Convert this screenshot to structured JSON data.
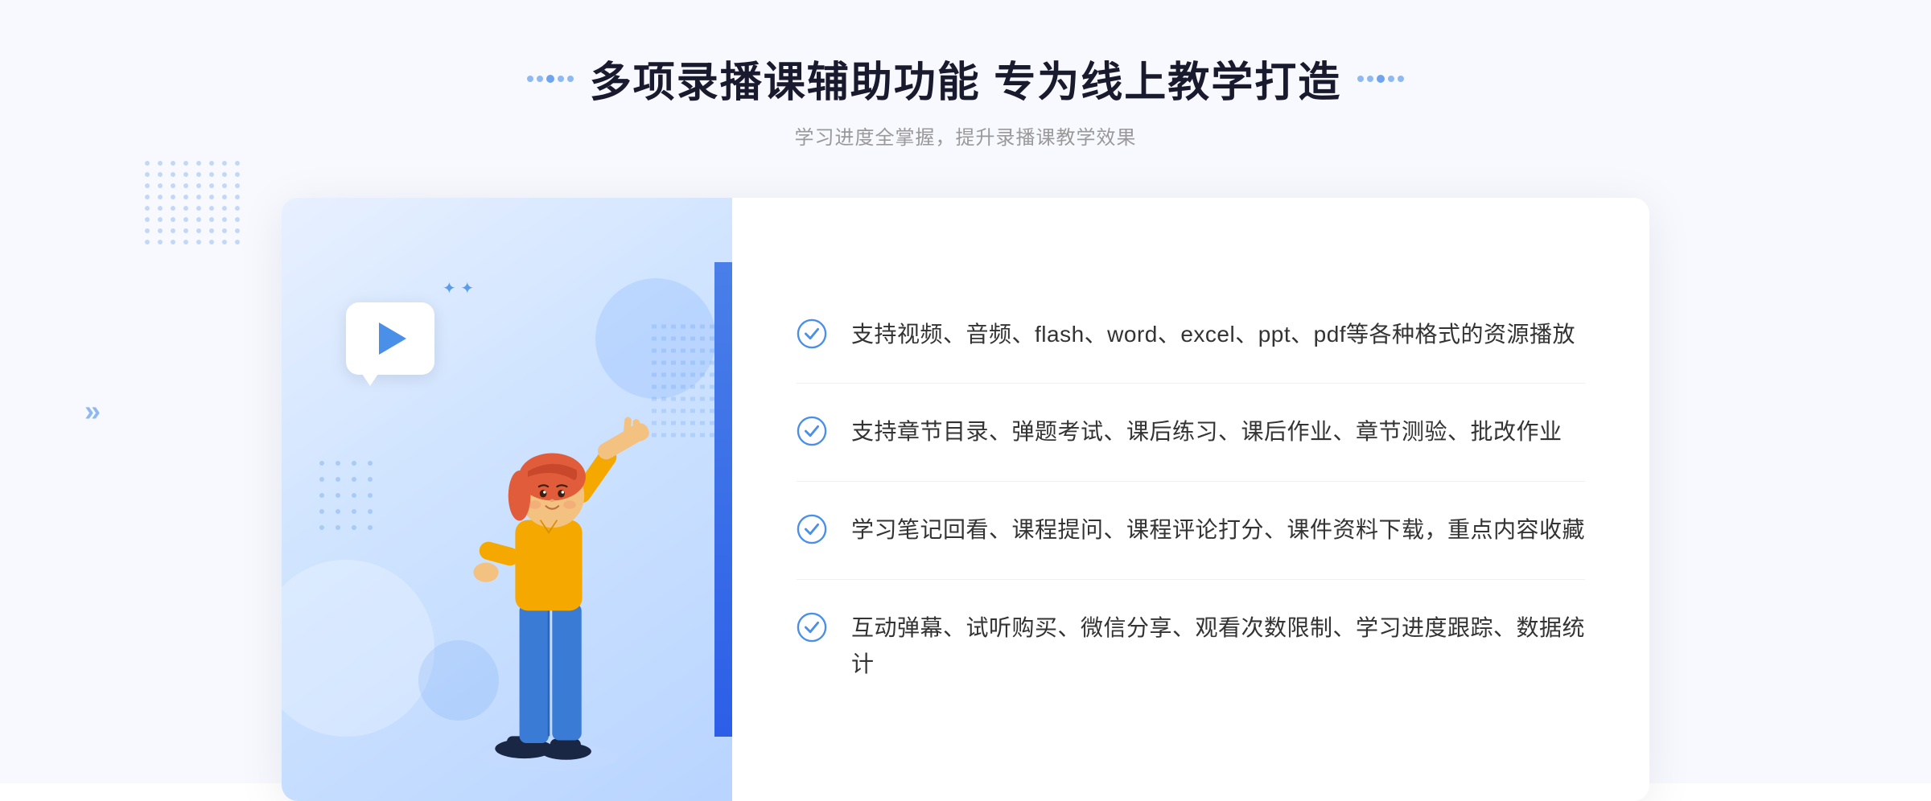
{
  "page": {
    "background": "#f8f9ff"
  },
  "header": {
    "title": "多项录播课辅助功能 专为线上教学打造",
    "subtitle": "学习进度全掌握，提升录播课教学效果",
    "title_decoration_left": "dots",
    "title_decoration_right": "dots"
  },
  "features": [
    {
      "id": 1,
      "text": "支持视频、音频、flash、word、excel、ppt、pdf等各种格式的资源播放"
    },
    {
      "id": 2,
      "text": "支持章节目录、弹题考试、课后练习、课后作业、章节测验、批改作业"
    },
    {
      "id": 3,
      "text": "学习笔记回看、课程提问、课程评论打分、课件资料下载，重点内容收藏"
    },
    {
      "id": 4,
      "text": "互动弹幕、试听购买、微信分享、观看次数限制、学习进度跟踪、数据统计"
    }
  ],
  "icons": {
    "check_circle": "check-circle-icon",
    "play": "play-icon",
    "chevron": "chevron-icon"
  },
  "colors": {
    "primary_blue": "#4a8fe8",
    "dark_blue": "#2c5ee8",
    "title_dark": "#1a1a2e",
    "text_gray": "#333333",
    "subtitle_gray": "#999999",
    "border_light": "#f0f0f0",
    "bg_light": "#f8f9ff",
    "accent_orange": "#f4a800"
  }
}
